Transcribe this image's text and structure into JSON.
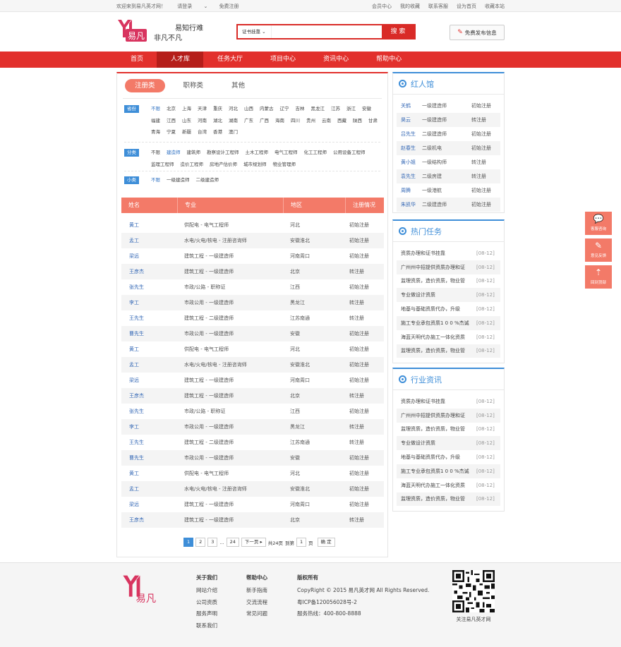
{
  "topbar": {
    "welcome": "欢迎来到易凡英才网！",
    "login": "请登录",
    "register": "免费注册",
    "links": [
      "会员中心",
      "我的收藏",
      "联系客服",
      "设为首页",
      "收藏本站"
    ]
  },
  "header": {
    "logo_text": "易凡",
    "slogan_top": "易知行难",
    "slogan_bottom": "非凡不凡",
    "search_select": "证书挂靠",
    "search_button": "搜 索",
    "publish_button": "免费发布信息"
  },
  "nav": {
    "items": [
      "首页",
      "人才库",
      "任务大厅",
      "项目中心",
      "资讯中心",
      "帮助中心"
    ],
    "active": "人才库"
  },
  "tabs": [
    "注册类",
    "职称类",
    "其他"
  ],
  "filters": {
    "province": {
      "label": "省份",
      "values": [
        "不限",
        "北京",
        "上海",
        "天津",
        "重庆",
        "河北",
        "山西",
        "内蒙古",
        "辽宁",
        "吉林",
        "黑龙江",
        "江苏",
        "浙江",
        "安徽",
        "福建",
        "江西",
        "山东",
        "河南",
        "湖北",
        "湖南",
        "广东",
        "广西",
        "海南",
        "四川",
        "贵州",
        "云南",
        "西藏",
        "陕西",
        "甘肃",
        "青海",
        "宁夏",
        "新疆",
        "台湾",
        "香港",
        "澳门"
      ]
    },
    "category": {
      "label": "分类",
      "values": [
        "不限",
        "建造师",
        "建筑师",
        "勘察设计工程师",
        "土木工程师",
        "电气工程师",
        "化工工程师",
        "公用设备工程师",
        "监理工程师",
        "造价工程师",
        "房地产估价师",
        "城市规划师",
        "物业管理师"
      ]
    },
    "subcategory": {
      "label": "小类",
      "values": [
        "不限",
        "一级建造师",
        "二级建造师"
      ]
    }
  },
  "table": {
    "headers": [
      "姓名",
      "专业",
      "地区",
      "注册情况"
    ],
    "rows": [
      [
        "黄工",
        "供配电 - 电气工程师",
        "河北",
        "初始注册"
      ],
      [
        "孟工",
        "水电/火电/核电 - 注册咨询师",
        "安徽淮北",
        "初始注册"
      ],
      [
        "梁远",
        "建筑工程 - 一级建造师",
        "河南周口",
        "初始注册"
      ],
      [
        "王彦杰",
        "建筑工程 - 一级建造师",
        "北京",
        "转注册"
      ],
      [
        "张先生",
        "市政/公路 - 职称证",
        "江西",
        "初始注册"
      ],
      [
        "李工",
        "市政公用 - 一级建造师",
        "黑龙江",
        "转注册"
      ],
      [
        "王先生",
        "建筑工程 - 二级建造师",
        "江苏南通",
        "转注册"
      ],
      [
        "曹先生",
        "市政公用 - 一级建造师",
        "安徽",
        "初始注册"
      ],
      [
        "黄工",
        "供配电 - 电气工程师",
        "河北",
        "初始注册"
      ],
      [
        "孟工",
        "水电/火电/核电 - 注册咨询师",
        "安徽淮北",
        "初始注册"
      ],
      [
        "梁远",
        "建筑工程 - 一级建造师",
        "河南周口",
        "初始注册"
      ],
      [
        "王彦杰",
        "建筑工程 - 一级建造师",
        "北京",
        "转注册"
      ],
      [
        "张先生",
        "市政/公路 - 职称证",
        "江西",
        "初始注册"
      ],
      [
        "李工",
        "市政公用 - 一级建造师",
        "黑龙江",
        "转注册"
      ],
      [
        "王先生",
        "建筑工程 - 二级建造师",
        "江苏南通",
        "转注册"
      ],
      [
        "曹先生",
        "市政公用 - 一级建造师",
        "安徽",
        "初始注册"
      ],
      [
        "黄工",
        "供配电 - 电气工程师",
        "河北",
        "初始注册"
      ],
      [
        "孟工",
        "水电/火电/核电 - 注册咨询师",
        "安徽淮北",
        "初始注册"
      ],
      [
        "梁远",
        "建筑工程 - 一级建造师",
        "河南周口",
        "初始注册"
      ],
      [
        "王彦杰",
        "建筑工程 - 一级建造师",
        "北京",
        "转注册"
      ]
    ]
  },
  "pager": {
    "pages": [
      "1",
      "2",
      "3",
      "...",
      "24"
    ],
    "current": "1",
    "next": "下一页",
    "total": "共24页",
    "goto_prefix": "到第",
    "goto_value": "1",
    "goto_suffix": "页",
    "confirm": "确 定"
  },
  "sidebar": {
    "talent": {
      "title": "红人馆",
      "rows": [
        [
          "关鹤",
          "一级建造师",
          "初始注册"
        ],
        [
          "昊云",
          "一级建造师",
          "转注册"
        ],
        [
          "吕先生",
          "二级建造师",
          "初始注册"
        ],
        [
          "赵春生",
          "二级机电",
          "初始注册"
        ],
        [
          "黄小姐",
          "一级结构师",
          "转注册"
        ],
        [
          "袁先生",
          "二级房建",
          "转注册"
        ],
        [
          "周腾",
          "一级港航",
          "初始注册"
        ],
        [
          "朱凯华",
          "二级建造师",
          "初始注册"
        ]
      ]
    },
    "tasks": {
      "title": "热门任务",
      "rows": [
        [
          "资质办理和证书挂靠",
          "[08-12]"
        ],
        [
          "广州州中招提供资质办理和证",
          "[08-12]"
        ],
        [
          "监理资质，造价资质，物业管",
          "[08-12]"
        ],
        [
          "专业做设计资质",
          "[08-12]"
        ],
        [
          "地基与基础资质代办，升级",
          "[08-12]"
        ],
        [
          "施工专业承包资质1 0 0 %杰诚",
          "[08-12]"
        ],
        [
          "海蓝天明代办施工一体化资质",
          "[08-12]"
        ],
        [
          "监理资质，造价资质，物业管",
          "[08-12]"
        ]
      ]
    },
    "news": {
      "title": "行业资讯",
      "rows": [
        [
          "资质办理和证书挂靠",
          "[08-12]"
        ],
        [
          "广州州中招提供资质办理和证",
          "[08-12]"
        ],
        [
          "监理资质，造价资质，物业管",
          "[08-12]"
        ],
        [
          "专业做设计资质",
          "[08-12]"
        ],
        [
          "地基与基础资质代办，升级",
          "[08-12]"
        ],
        [
          "施工专业承包资质1 0 0 %杰诚",
          "[08-12]"
        ],
        [
          "海蓝天明代办施工一体化资质",
          "[08-12]"
        ],
        [
          "监理资质，造价资质，物业管",
          "[08-12]"
        ]
      ]
    }
  },
  "float_tools": [
    "客服咨询",
    "意见反馈",
    "回到顶部"
  ],
  "footer": {
    "about": {
      "title": "关于我们",
      "links": [
        "网站介绍",
        "公司资质",
        "服务声明",
        "联系我们"
      ]
    },
    "help": {
      "title": "帮助中心",
      "links": [
        "新手指南",
        "交流流程",
        "常见问题"
      ]
    },
    "copyright": {
      "title": "版权所有",
      "lines": [
        "CopyRight © 2015 易凡英才网 All Rights Reserved.",
        "粤ICP备120056028号-2",
        "服务热线：400-800-8888"
      ]
    },
    "qr_caption": "关注易凡英才网"
  },
  "colors": {
    "brand_red": "#e2302c",
    "accent_salmon": "#f37a68",
    "link_blue": "#3367b5",
    "sidebar_blue": "#3e8ed8"
  }
}
